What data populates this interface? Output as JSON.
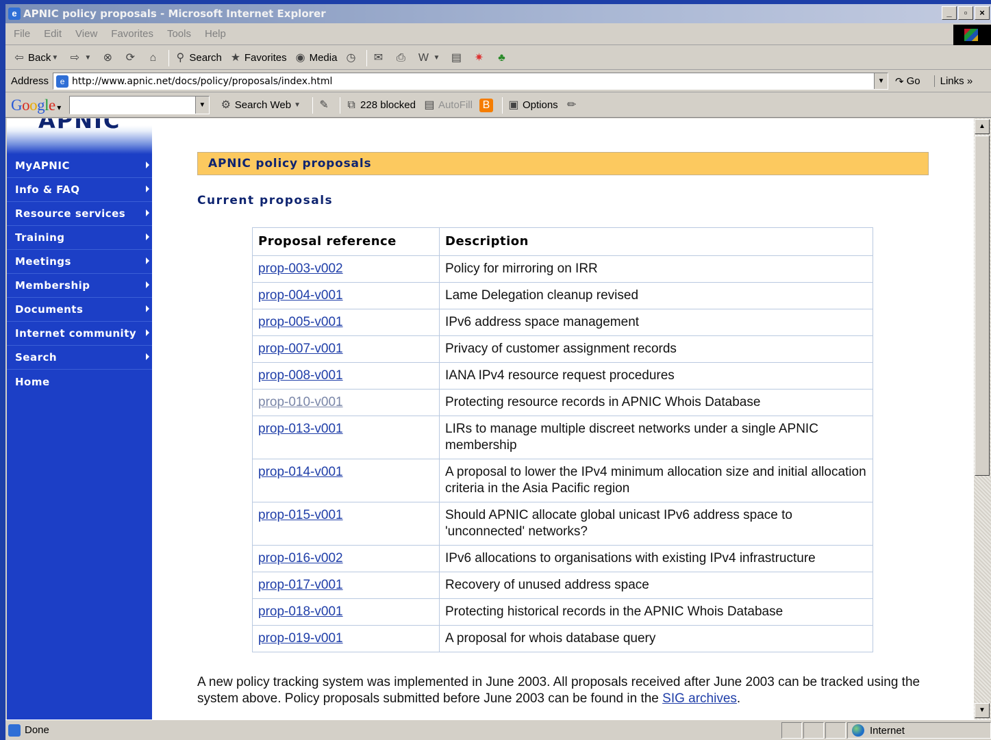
{
  "window": {
    "title": "APNIC policy proposals - Microsoft Internet Explorer",
    "controls": [
      "_",
      "▫",
      "×"
    ]
  },
  "menubar": [
    "File",
    "Edit",
    "View",
    "Favorites",
    "Tools",
    "Help"
  ],
  "toolbar": {
    "back": "Back",
    "search": "Search",
    "favorites": "Favorites",
    "media": "Media"
  },
  "addressbar": {
    "label": "Address",
    "url": "http://www.apnic.net/docs/policy/proposals/index.html",
    "go": "Go",
    "links": "Links"
  },
  "googlebar": {
    "search_web": "Search Web",
    "blocked": "228 blocked",
    "autofill": "AutoFill",
    "options": "Options"
  },
  "sidebar": {
    "logo_text": "APNIC",
    "items": [
      {
        "label": "MyAPNIC",
        "submenu": true
      },
      {
        "label": "Info & FAQ",
        "submenu": true
      },
      {
        "label": "Resource services",
        "submenu": true
      },
      {
        "label": "Training",
        "submenu": true
      },
      {
        "label": "Meetings",
        "submenu": true
      },
      {
        "label": "Membership",
        "submenu": true
      },
      {
        "label": "Documents",
        "submenu": true
      },
      {
        "label": "Internet community",
        "submenu": true
      },
      {
        "label": "Search",
        "submenu": true
      },
      {
        "label": "Home",
        "submenu": false
      }
    ]
  },
  "main": {
    "page_title": "APNIC policy proposals",
    "section_title": "Current proposals",
    "table": {
      "headers": [
        "Proposal reference",
        "Description"
      ],
      "rows": [
        {
          "ref": "prop-003-v002",
          "desc": "Policy for mirroring on IRR",
          "visited": false
        },
        {
          "ref": "prop-004-v001",
          "desc": "Lame Delegation cleanup revised",
          "visited": false
        },
        {
          "ref": "prop-005-v001",
          "desc": "IPv6 address space management",
          "visited": false
        },
        {
          "ref": "prop-007-v001",
          "desc": "Privacy of customer assignment records",
          "visited": false
        },
        {
          "ref": "prop-008-v001",
          "desc": "IANA IPv4 resource request procedures",
          "visited": false
        },
        {
          "ref": "prop-010-v001",
          "desc": "Protecting resource records in APNIC Whois Database",
          "visited": true
        },
        {
          "ref": "prop-013-v001",
          "desc": "LIRs to manage multiple discreet networks under a single APNIC membership",
          "visited": false
        },
        {
          "ref": "prop-014-v001",
          "desc": "A proposal to lower the IPv4 minimum allocation size and initial allocation criteria in the Asia Pacific region",
          "visited": false
        },
        {
          "ref": "prop-015-v001",
          "desc": "Should APNIC allocate global unicast IPv6 address space to 'unconnected' networks?",
          "visited": false
        },
        {
          "ref": "prop-016-v002",
          "desc": "IPv6 allocations to organisations with existing IPv4 infrastructure",
          "visited": false
        },
        {
          "ref": "prop-017-v001",
          "desc": "Recovery of unused address space",
          "visited": false
        },
        {
          "ref": "prop-018-v001",
          "desc": "Protecting historical records in the APNIC Whois Database",
          "visited": false
        },
        {
          "ref": "prop-019-v001",
          "desc": "A proposal for whois database query",
          "visited": false
        }
      ]
    },
    "note": {
      "text": "A new policy tracking system was implemented in June 2003. All proposals received after June 2003 can be tracked using the system above. Policy proposals submitted before June 2003 can be found in the ",
      "link": "SIG archives",
      "end": "."
    }
  },
  "statusbar": {
    "status": "Done",
    "zone": "Internet"
  }
}
